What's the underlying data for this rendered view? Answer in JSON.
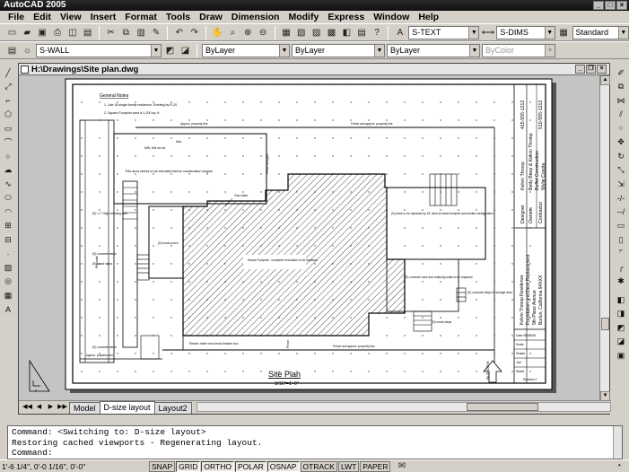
{
  "app": {
    "title": "AutoCAD 2005"
  },
  "menu": [
    "File",
    "Edit",
    "View",
    "Insert",
    "Format",
    "Tools",
    "Draw",
    "Dimension",
    "Modify",
    "Express",
    "Window",
    "Help"
  ],
  "toolbar": {
    "textstyle": "S-TEXT",
    "dimstyle": "S-DIMS",
    "tablestyle": "Standard",
    "layer": "S-WALL",
    "color": "ByLayer",
    "linetype": "ByLayer",
    "lineweight": "ByLayer",
    "plotstyle": "ByColor"
  },
  "drawing": {
    "window_title": "H:\\Drawings\\Site plan.dwg",
    "notes_title": "General Notes",
    "note_1": "1.  Use 16 single-family residence. Existing by R-20.",
    "note_2": "2.  Square Footprint area is 1,200 sq. ft.",
    "property_top": "Approx. property line",
    "fence_top": "Fence and approx. property line",
    "asphalt": "N/B, this six sh.",
    "asphalt_2": "Sub.",
    "area_note": "This area needs to be elevated before construction begins.",
    "gas_meter": "Gas meter",
    "fence_gate": "Fence and gate",
    "stair": "(E) 1-7' High retaining wall",
    "wood_porch": "(N) wood porch",
    "concrete_steps": "(E) concrete steps",
    "wood_steps": "(E) wood steps",
    "remodel": "Remodel",
    "existing": "Existing",
    "house_footprint": "House Footprint - complete renovation to be replaced",
    "deck_note": "(N) deck to be replaced by 16' deck at same footprint and similar configuration",
    "new_area": "(E) concrete area and retaining walls to be replaced",
    "wood_steps_2": "(N) wood steps",
    "concrete_steps_2": "(E) concrete steps to storage area",
    "concrete_steps_3": "(E) concrete steps",
    "approx_prop": "approx. property line",
    "elec_meter": "Electric meter and circuit breaker box",
    "fence_bottom": "Fence and approx. property line",
    "fence_side": "Fence",
    "plan_title": "Site Plan",
    "plan_scale": "3/16\"=1'-0\"",
    "north": "TRUE NORTH",
    "tb_contact_1": "415-555-1212",
    "tb_contact_2": "510-555-1212",
    "tb_designer": "Designer",
    "tb_owners": "Owners",
    "tb_contractor": "Contractor",
    "tb_names_1": "Kelvin Throop",
    "tb_names_2": "Betty Boop & Kelvin Throop",
    "tb_names_3": "Buffet Construction",
    "tb_names_4": "Wylie Coyote",
    "tb_project_1": "Kelvin Throop Residence",
    "tb_project_2": "Foundation and Deck Replacement",
    "tb_project_3": "9th Place Avenue",
    "tb_project_4": "Burlun, California 94XXX",
    "tb_date": "Date 05/01/05",
    "tb_scale": "Scale",
    "tb_drawn": "Drawn",
    "tb_job": "Job",
    "tb_sheet": "Sheet",
    "tb_sheetnum": "Revision 2"
  },
  "tabs": [
    "Model",
    "D-size layout",
    "Layout2"
  ],
  "active_tab": "D-size layout",
  "command": {
    "line1": "Command:  <Switching to: D-size layout>",
    "line2": "Restoring cached viewports - Regenerating layout.",
    "line3": "Command:"
  },
  "status": {
    "coords": "1'-6 1/4\", 0'-0 1/16\", 0'-0\"",
    "buttons": [
      "SNAP",
      "GRID",
      "ORTHO",
      "POLAR",
      "OSNAP",
      "OTRACK",
      "LWT",
      "PAPER"
    ],
    "on_buttons": [
      "GRID",
      "ORTHO",
      "POLAR",
      "OSNAP"
    ]
  }
}
